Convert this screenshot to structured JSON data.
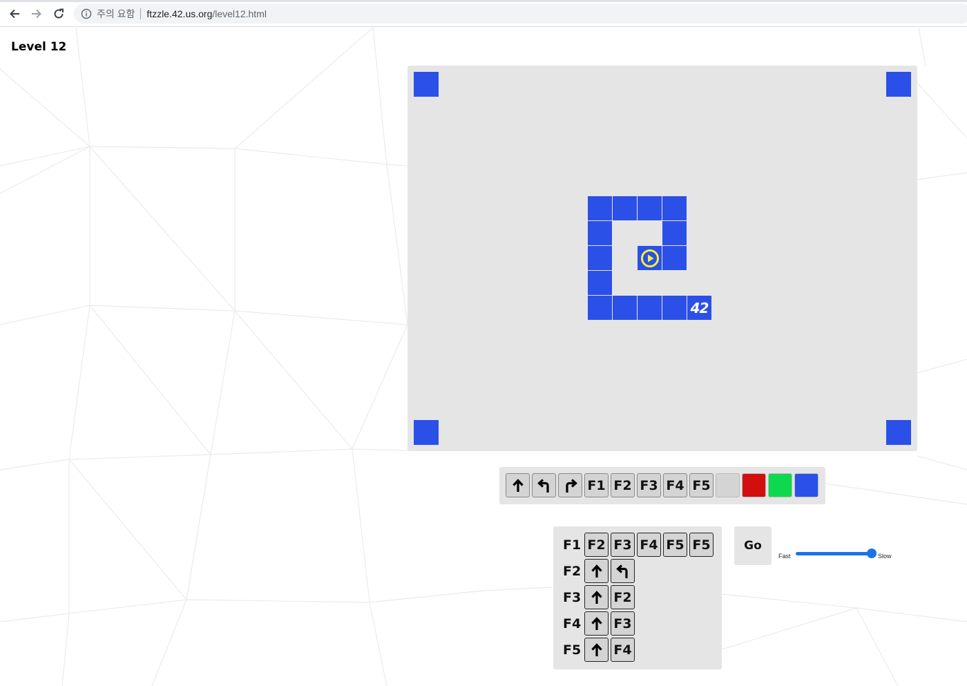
{
  "browser": {
    "security_label": "주의 요함",
    "url_host": "ftzzle.42.us.org",
    "url_path": "/level12.html"
  },
  "page": {
    "title": "Level 12"
  },
  "board": {
    "tile_color": "#2b50e8",
    "robot_color": "#f5f035",
    "goal_label": "42"
  },
  "toolbar": {
    "tools": [
      {
        "kind": "forward",
        "label": ""
      },
      {
        "kind": "turn-left",
        "label": ""
      },
      {
        "kind": "turn-right",
        "label": ""
      },
      {
        "kind": "function",
        "label": "F1"
      },
      {
        "kind": "function",
        "label": "F2"
      },
      {
        "kind": "function",
        "label": "F3"
      },
      {
        "kind": "function",
        "label": "F4"
      },
      {
        "kind": "function",
        "label": "F5"
      },
      {
        "kind": "color",
        "label": "",
        "color": "#d4d4d4"
      },
      {
        "kind": "color",
        "label": "",
        "color": "#d10f0f"
      },
      {
        "kind": "color",
        "label": "",
        "color": "#10d84e"
      },
      {
        "kind": "color",
        "label": "",
        "color": "#2b50e8"
      }
    ]
  },
  "program": {
    "functions": [
      {
        "name": "F1",
        "slots": [
          "F2",
          "F3",
          "F4",
          "F5",
          "F5"
        ]
      },
      {
        "name": "F2",
        "slots": [
          "forward",
          "turn-left"
        ]
      },
      {
        "name": "F3",
        "slots": [
          "forward",
          "F2"
        ]
      },
      {
        "name": "F4",
        "slots": [
          "forward",
          "F3"
        ]
      },
      {
        "name": "F5",
        "slots": [
          "forward",
          "F4"
        ]
      }
    ]
  },
  "controls": {
    "go_label": "Go",
    "speed_fast_label": "Fast",
    "speed_slow_label": "Slow",
    "speed_value": 1.0
  }
}
